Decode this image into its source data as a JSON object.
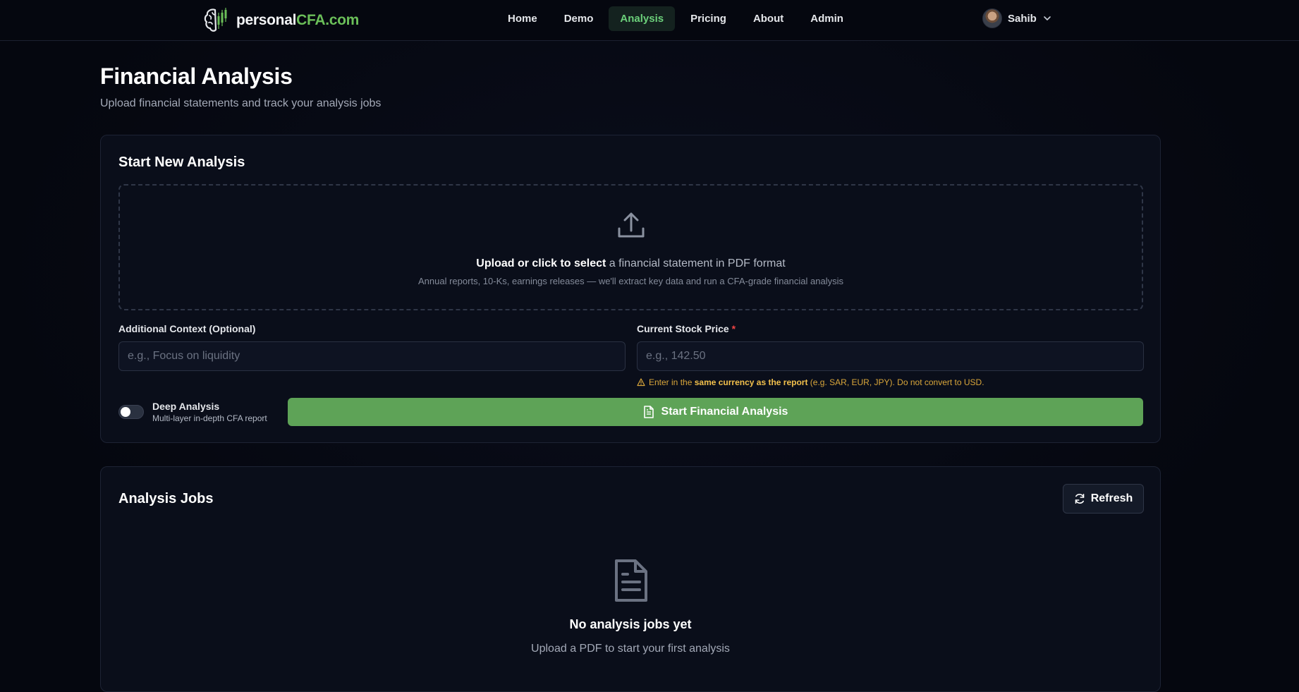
{
  "brand": {
    "name_prefix": "personal",
    "name_highlight": "CFA.com"
  },
  "nav": {
    "links": [
      {
        "label": "Home"
      },
      {
        "label": "Demo"
      },
      {
        "label": "Analysis",
        "active": true
      },
      {
        "label": "Pricing"
      },
      {
        "label": "About"
      },
      {
        "label": "Admin"
      }
    ],
    "user": {
      "name": "Sahib"
    }
  },
  "header": {
    "title": "Financial Analysis",
    "subtitle": "Upload financial statements and track your analysis jobs"
  },
  "new_analysis": {
    "title": "Start New Analysis",
    "dropzone": {
      "main_bold": "Upload or click to select",
      "main_rest": " a financial statement in PDF format",
      "sub": "Annual reports, 10-Ks, earnings releases — we'll extract key data and run a CFA-grade financial analysis"
    },
    "context": {
      "label": "Additional Context (Optional)",
      "placeholder": "e.g., Focus on liquidity",
      "value": ""
    },
    "price": {
      "label": "Current Stock Price",
      "required_mark": "*",
      "placeholder": "e.g., 142.50",
      "value": "",
      "warning_prefix": "Enter in the ",
      "warning_bold": "same currency as the report",
      "warning_suffix": " (e.g. SAR, EUR, JPY). Do not convert to USD."
    },
    "deep_analysis": {
      "label": "Deep Analysis",
      "description": "Multi-layer in-depth CFA report",
      "enabled": false
    },
    "start_button": "Start Financial Analysis"
  },
  "jobs": {
    "title": "Analysis Jobs",
    "refresh_label": "Refresh",
    "empty_title": "No analysis jobs yet",
    "empty_subtitle": "Upload a PDF to start your first analysis"
  },
  "colors": {
    "accent_green": "#5ea357",
    "brand_green": "#6bbf59",
    "warning": "#d9a63a",
    "background": "#05070f"
  }
}
